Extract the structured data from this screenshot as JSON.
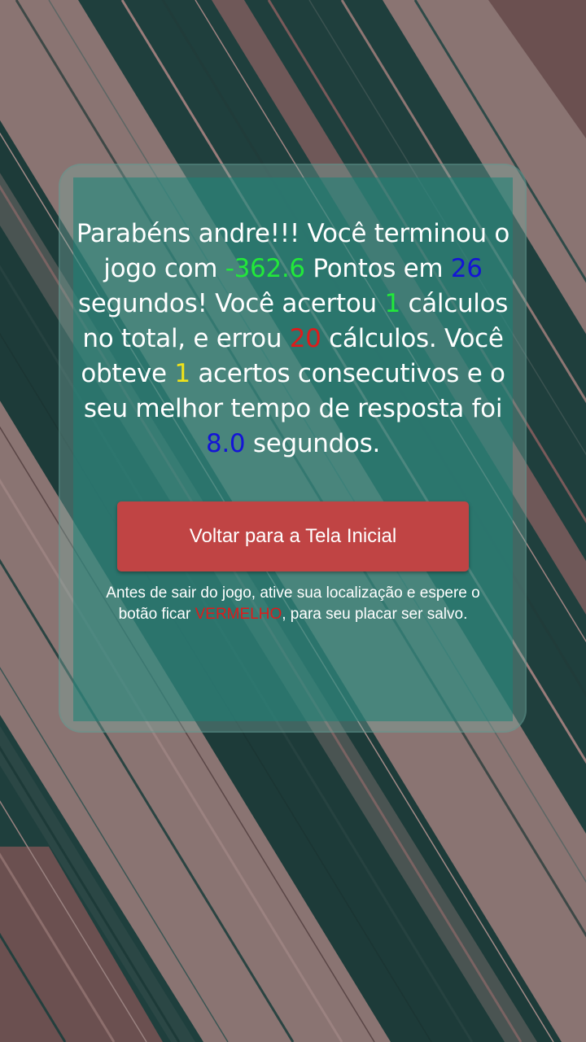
{
  "result": {
    "t1": "Parabéns andre!!! Você terminou o jogo com ",
    "score": "-362.6",
    "t2": " Pontos em ",
    "time": "26",
    "t3": " segundos! Você acertou ",
    "correct": "1",
    "t4": " cálculos no total, e errou ",
    "wrong": "20",
    "t5": " cálculos. Você obteve ",
    "streak": "1",
    "t6": " acertos consecutivos e o seu melhor tempo de resposta foi ",
    "best_time": "8.0",
    "t7": " segundos."
  },
  "back_button_label": "Voltar para a Tela Inicial",
  "notice": {
    "before": "Antes de sair do jogo, ative sua localização e espere o botão ficar ",
    "highlight": "VERMELHO",
    "after": ", para seu placar ser salvo."
  },
  "colors": {
    "background_mauve": "#8a7472",
    "stripe_dark_green": "#1f3f3d",
    "card_teal": "#1a8276",
    "button_red": "#c04444",
    "value_green": "#22e83a",
    "value_blue": "#1414d6",
    "value_red": "#e01a1a",
    "value_yellow": "#f0e21a"
  }
}
